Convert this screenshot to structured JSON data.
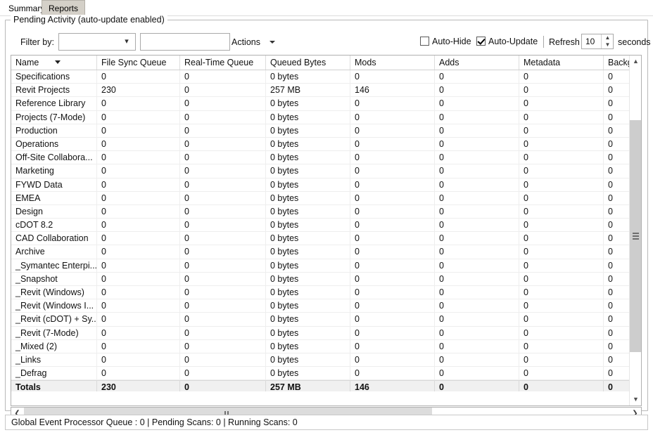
{
  "tabs": [
    {
      "label": "Summary",
      "active": false
    },
    {
      "label": "Reports",
      "active": true
    }
  ],
  "groupbox": {
    "title": "Pending Activity (auto-update enabled)"
  },
  "toolbar": {
    "filter_label": "Filter by:",
    "filter_combo_value": "",
    "filter_text_value": "",
    "filter_text_placeholder": "",
    "actions_label": "Actions",
    "auto_hide_label": "Auto-Hide",
    "auto_hide_checked": false,
    "auto_update_label": "Auto-Update",
    "auto_update_checked": true,
    "refresh_label": "Refresh",
    "refresh_value": "10",
    "seconds_label": "seconds"
  },
  "grid": {
    "columns": [
      {
        "label": "Name",
        "sorted": true
      },
      {
        "label": "File Sync Queue"
      },
      {
        "label": "Real-Time Queue"
      },
      {
        "label": "Queued Bytes"
      },
      {
        "label": "Mods"
      },
      {
        "label": "Adds"
      },
      {
        "label": "Metadata"
      },
      {
        "label": "Backgro"
      }
    ],
    "rows": [
      {
        "name": "Specifications",
        "file_sync": "0",
        "real_time": "0",
        "queued_bytes": "0 bytes",
        "mods": "0",
        "adds": "0",
        "metadata": "0",
        "background": "0"
      },
      {
        "name": "Revit Projects",
        "file_sync": "230",
        "real_time": "0",
        "queued_bytes": "257 MB",
        "mods": "146",
        "adds": "0",
        "metadata": "0",
        "background": "0"
      },
      {
        "name": "Reference Library",
        "file_sync": "0",
        "real_time": "0",
        "queued_bytes": "0 bytes",
        "mods": "0",
        "adds": "0",
        "metadata": "0",
        "background": "0"
      },
      {
        "name": "Projects (7-Mode)",
        "file_sync": "0",
        "real_time": "0",
        "queued_bytes": "0 bytes",
        "mods": "0",
        "adds": "0",
        "metadata": "0",
        "background": "0"
      },
      {
        "name": "Production",
        "file_sync": "0",
        "real_time": "0",
        "queued_bytes": "0 bytes",
        "mods": "0",
        "adds": "0",
        "metadata": "0",
        "background": "0"
      },
      {
        "name": "Operations",
        "file_sync": "0",
        "real_time": "0",
        "queued_bytes": "0 bytes",
        "mods": "0",
        "adds": "0",
        "metadata": "0",
        "background": "0"
      },
      {
        "name": "Off-Site Collabora...",
        "file_sync": "0",
        "real_time": "0",
        "queued_bytes": "0 bytes",
        "mods": "0",
        "adds": "0",
        "metadata": "0",
        "background": "0"
      },
      {
        "name": "Marketing",
        "file_sync": "0",
        "real_time": "0",
        "queued_bytes": "0 bytes",
        "mods": "0",
        "adds": "0",
        "metadata": "0",
        "background": "0"
      },
      {
        "name": "FYWD Data",
        "file_sync": "0",
        "real_time": "0",
        "queued_bytes": "0 bytes",
        "mods": "0",
        "adds": "0",
        "metadata": "0",
        "background": "0"
      },
      {
        "name": "EMEA",
        "file_sync": "0",
        "real_time": "0",
        "queued_bytes": "0 bytes",
        "mods": "0",
        "adds": "0",
        "metadata": "0",
        "background": "0"
      },
      {
        "name": "Design",
        "file_sync": "0",
        "real_time": "0",
        "queued_bytes": "0 bytes",
        "mods": "0",
        "adds": "0",
        "metadata": "0",
        "background": "0"
      },
      {
        "name": "cDOT 8.2",
        "file_sync": "0",
        "real_time": "0",
        "queued_bytes": "0 bytes",
        "mods": "0",
        "adds": "0",
        "metadata": "0",
        "background": "0"
      },
      {
        "name": "CAD Collaboration",
        "file_sync": "0",
        "real_time": "0",
        "queued_bytes": "0 bytes",
        "mods": "0",
        "adds": "0",
        "metadata": "0",
        "background": "0"
      },
      {
        "name": "Archive",
        "file_sync": "0",
        "real_time": "0",
        "queued_bytes": "0 bytes",
        "mods": "0",
        "adds": "0",
        "metadata": "0",
        "background": "0"
      },
      {
        "name": "_Symantec Enterpi...",
        "file_sync": "0",
        "real_time": "0",
        "queued_bytes": "0 bytes",
        "mods": "0",
        "adds": "0",
        "metadata": "0",
        "background": "0"
      },
      {
        "name": "_Snapshot",
        "file_sync": "0",
        "real_time": "0",
        "queued_bytes": "0 bytes",
        "mods": "0",
        "adds": "0",
        "metadata": "0",
        "background": "0"
      },
      {
        "name": "_Revit (Windows)",
        "file_sync": "0",
        "real_time": "0",
        "queued_bytes": "0 bytes",
        "mods": "0",
        "adds": "0",
        "metadata": "0",
        "background": "0"
      },
      {
        "name": "_Revit (Windows I...",
        "file_sync": "0",
        "real_time": "0",
        "queued_bytes": "0 bytes",
        "mods": "0",
        "adds": "0",
        "metadata": "0",
        "background": "0"
      },
      {
        "name": "_Revit (cDOT) + Sy...",
        "file_sync": "0",
        "real_time": "0",
        "queued_bytes": "0 bytes",
        "mods": "0",
        "adds": "0",
        "metadata": "0",
        "background": "0"
      },
      {
        "name": "_Revit (7-Mode)",
        "file_sync": "0",
        "real_time": "0",
        "queued_bytes": "0 bytes",
        "mods": "0",
        "adds": "0",
        "metadata": "0",
        "background": "0"
      },
      {
        "name": "_Mixed (2)",
        "file_sync": "0",
        "real_time": "0",
        "queued_bytes": "0 bytes",
        "mods": "0",
        "adds": "0",
        "metadata": "0",
        "background": "0"
      },
      {
        "name": "_Links",
        "file_sync": "0",
        "real_time": "0",
        "queued_bytes": "0 bytes",
        "mods": "0",
        "adds": "0",
        "metadata": "0",
        "background": "0"
      },
      {
        "name": "_Defrag",
        "file_sync": "0",
        "real_time": "0",
        "queued_bytes": "0 bytes",
        "mods": "0",
        "adds": "0",
        "metadata": "0",
        "background": "0"
      }
    ],
    "totals": {
      "name": "Totals",
      "file_sync": "230",
      "real_time": "0",
      "queued_bytes": "257 MB",
      "mods": "146",
      "adds": "0",
      "metadata": "0",
      "background": "0"
    }
  },
  "statusbar": {
    "text": "Global Event Processor Queue : 0 | Pending Scans: 0 | Running Scans: 0"
  }
}
